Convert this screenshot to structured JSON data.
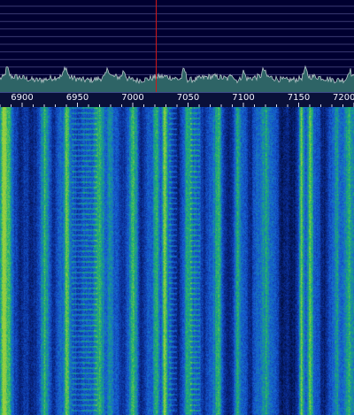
{
  "spectrum": {
    "freq_start": 6880,
    "freq_end": 7200,
    "tuned_freq": 7021,
    "colors": {
      "background": "#000030",
      "grid_line": "#3a3a72",
      "trace_fill": "#2e6466",
      "trace_line": "#b8c8c8",
      "tuning_marker": "#d01818"
    }
  },
  "frequency_scale": {
    "labels": [
      "6900",
      "6950",
      "7000",
      "7050",
      "7100",
      "7150",
      "7200"
    ]
  },
  "waterfall": {
    "palette": [
      "#000a30",
      "#0a2a90",
      "#1660d8",
      "#1ab070",
      "#9ad040"
    ]
  }
}
